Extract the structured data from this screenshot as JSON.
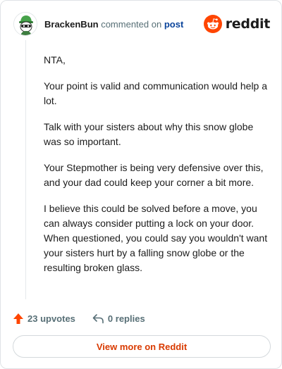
{
  "comment": {
    "username": "BrackenBun",
    "action_text": "commented on",
    "post_link": "post",
    "paragraphs": [
      "NTA,",
      "Your point is valid and communication would help a lot.",
      "Talk with your sisters about why this snow globe was so important.",
      "Your Stepmother is being very defensive over this, and your dad could keep your corner a bit more.",
      "I believe this could be solved before a move, you can always consider putting a lock on your door. When questioned, you could say you wouldn't want your sisters hurt by a falling snow globe or the resulting broken glass."
    ]
  },
  "brand": {
    "name": "reddit",
    "color": "#ff4500"
  },
  "footer": {
    "upvotes": "23 upvotes",
    "replies": "0 replies",
    "view_more": "View more on Reddit"
  },
  "colors": {
    "accent": "#ff4500",
    "link": "#0a449b",
    "muted": "#576f76",
    "view_more_text": "#d93a00"
  },
  "icons": {
    "avatar": "snoo-avatar-icon",
    "logo": "reddit-logo-icon",
    "upvote": "upvote-arrow-icon",
    "reply": "reply-arrow-icon"
  }
}
